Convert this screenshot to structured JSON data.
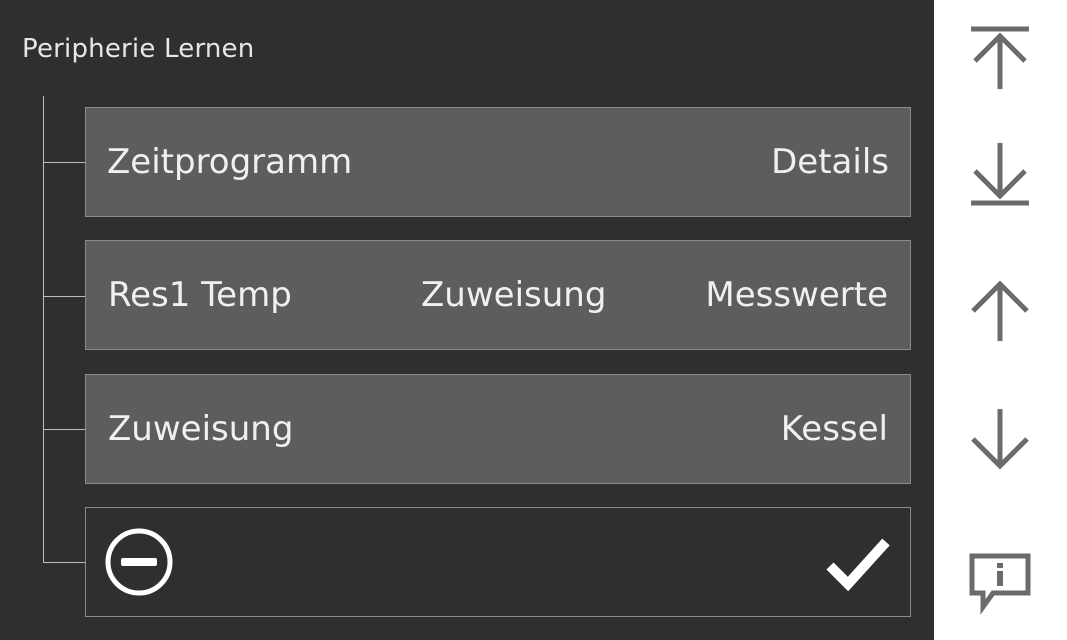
{
  "header": {
    "title": "Peripherie Lernen"
  },
  "rows": [
    {
      "left": "Zeitprogramm",
      "right": "Details"
    },
    {
      "left": "Res1 Temp",
      "middle": "Zuweisung",
      "right": "Messwerte"
    },
    {
      "left": "Zuweisung",
      "right": "Kessel"
    }
  ],
  "actions": {
    "cancel_icon": "minus-circle-icon",
    "confirm_icon": "checkmark-icon"
  },
  "sidebar": {
    "icons": [
      "scroll-to-top-icon",
      "scroll-to-bottom-icon",
      "arrow-up-icon",
      "arrow-down-icon",
      "info-message-icon"
    ]
  },
  "colors": {
    "background": "#2f2f2f",
    "row": "#5d5d5d",
    "text": "#f0f0f0",
    "sidebar_icon": "#6b6b6b"
  }
}
